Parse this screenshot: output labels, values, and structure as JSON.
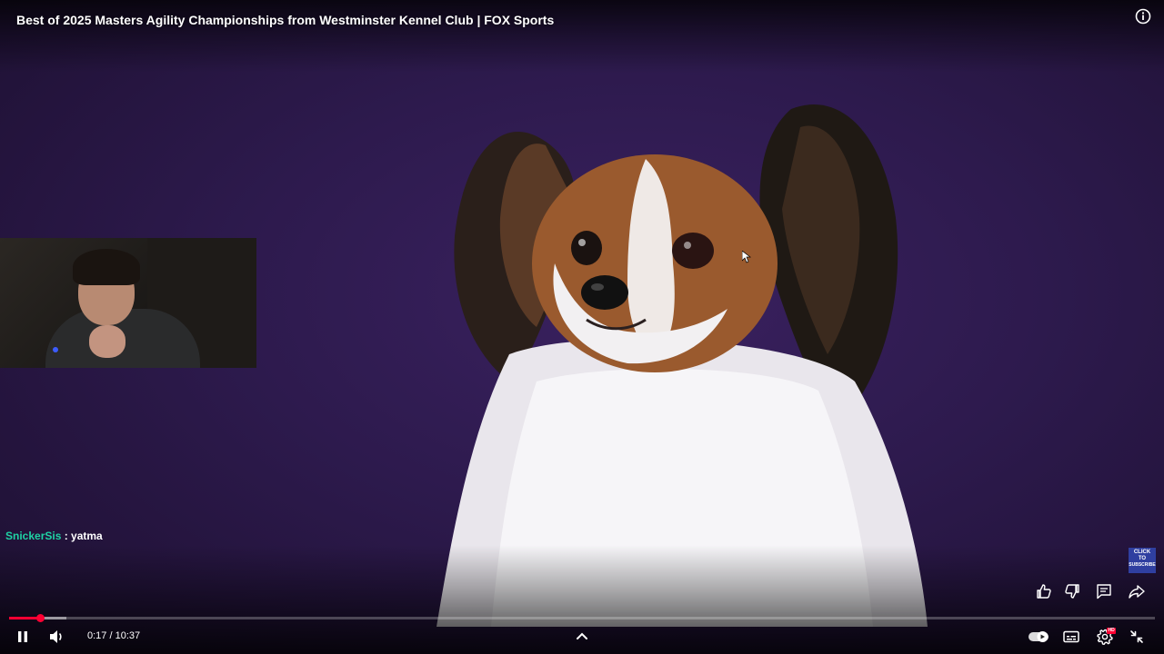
{
  "video": {
    "title": "Best of 2025 Masters Agility Championships from Westminster Kennel Club | FOX Sports",
    "info_icon": "info-icon"
  },
  "chat": {
    "username": "SnickerSis",
    "separator": " : ",
    "message": "yatma"
  },
  "subscribe_badge": {
    "line1": "CLICK",
    "line2": "TO",
    "line3": "SUBSCRIBE"
  },
  "player": {
    "current_time": "0:17",
    "time_separator": " / ",
    "duration": "10:37",
    "progress_fraction": 0.027,
    "buffered_fraction": 0.05,
    "autoplay_on": true,
    "hd_badge": "HD",
    "colors": {
      "progress": "#ff0033",
      "chat_username": "#1fd3a4",
      "background": "#2d1a4d"
    },
    "icons": [
      "pause-icon",
      "volume-icon",
      "chevron-up-icon",
      "autoplay-toggle-icon",
      "subtitles-icon",
      "settings-icon",
      "exit-fullscreen-icon",
      "like-icon",
      "dislike-icon",
      "comments-icon",
      "share-icon"
    ]
  }
}
